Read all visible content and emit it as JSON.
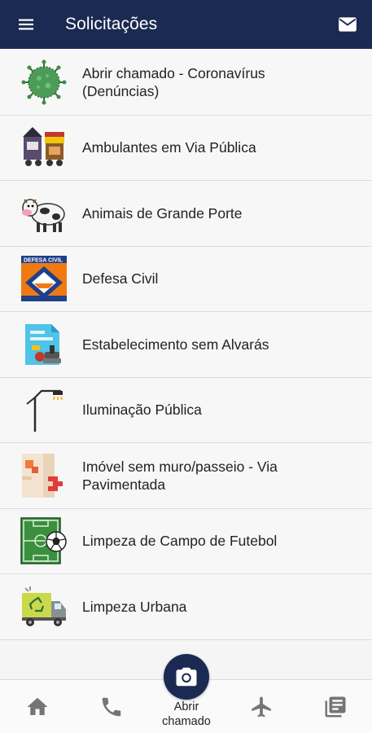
{
  "header": {
    "title": "Solicitações",
    "menu_icon": "hamburger-menu-icon",
    "mail_icon": "mail-icon",
    "background_color": "#1b2a52"
  },
  "requests": [
    {
      "label_line1": "Abrir chamado - Coronavírus",
      "label_line2": "(Denúncias)",
      "icon": "coronavirus-icon"
    },
    {
      "label_line1": "Ambulantes em Via Pública",
      "label_line2": "",
      "icon": "street-vendor-icon"
    },
    {
      "label_line1": "Animais de Grande Porte",
      "label_line2": "",
      "icon": "cow-icon"
    },
    {
      "label_line1": "Defesa Civil",
      "label_line2": "",
      "icon": "civil-defense-logo-icon",
      "icon_text": "DEFESA CIVIL"
    },
    {
      "label_line1": "Estabelecimento sem Alvarás",
      "label_line2": "",
      "icon": "permit-stamp-icon"
    },
    {
      "label_line1": "Iluminação Pública",
      "label_line2": "",
      "icon": "street-lamp-icon"
    },
    {
      "label_line1": "Imóvel sem muro/passeio - Via",
      "label_line2": "Pavimentada",
      "icon": "broken-wall-icon"
    },
    {
      "label_line1": "Limpeza de Campo de Futebol",
      "label_line2": "",
      "icon": "soccer-field-icon"
    },
    {
      "label_line1": "Limpeza Urbana",
      "label_line2": "",
      "icon": "garbage-truck-icon"
    }
  ],
  "bottom_nav": {
    "home_icon": "home-icon",
    "phone_icon": "phone-icon",
    "camera_icon": "camera-icon",
    "camera_label_line1": "Abrir",
    "camera_label_line2": "chamado",
    "airplane_icon": "airplane-icon",
    "news_icon": "news-icon"
  }
}
